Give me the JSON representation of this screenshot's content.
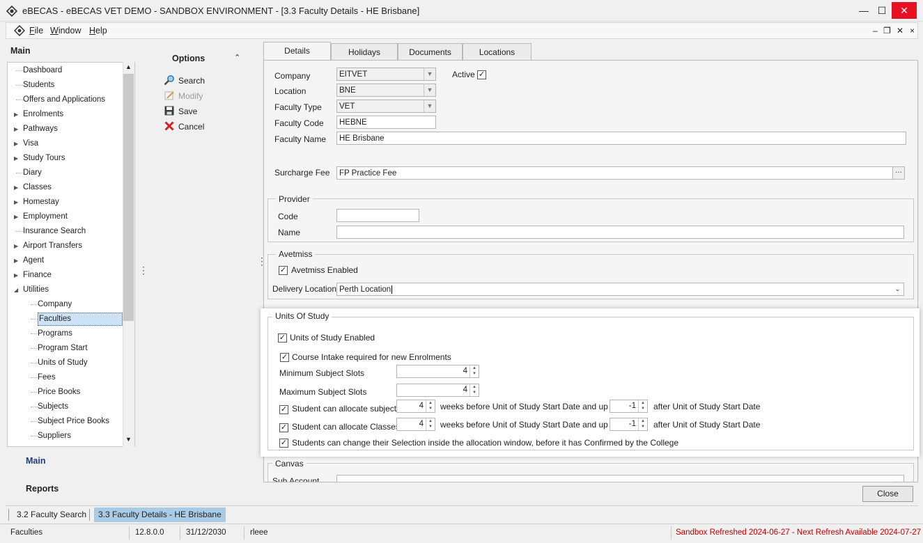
{
  "window": {
    "title": "eBECAS - eBECAS VET DEMO - SANDBOX ENVIRONMENT - [3.3 Faculty Details - HE Brisbane]",
    "minimize_glyph": "—",
    "maximize_glyph": "☐",
    "close_glyph": "✕"
  },
  "menu": {
    "items": [
      "File",
      "Window",
      "Help"
    ],
    "mdi_controls": [
      "‒",
      "❐",
      "✕",
      "×"
    ]
  },
  "nav": {
    "title": "Main",
    "tree": [
      {
        "label": "Dashboard",
        "expandable": false,
        "child": false
      },
      {
        "label": "Students",
        "expandable": false,
        "child": false
      },
      {
        "label": "Offers and Applications",
        "expandable": false,
        "child": false
      },
      {
        "label": "Enrolments",
        "expandable": true,
        "child": false
      },
      {
        "label": "Pathways",
        "expandable": true,
        "child": false
      },
      {
        "label": "Visa",
        "expandable": true,
        "child": false
      },
      {
        "label": "Study Tours",
        "expandable": true,
        "child": false
      },
      {
        "label": "Diary",
        "expandable": false,
        "child": false
      },
      {
        "label": "Classes",
        "expandable": true,
        "child": false
      },
      {
        "label": "Homestay",
        "expandable": true,
        "child": false
      },
      {
        "label": "Employment",
        "expandable": true,
        "child": false
      },
      {
        "label": "Insurance Search",
        "expandable": false,
        "child": false
      },
      {
        "label": "Airport Transfers",
        "expandable": true,
        "child": false
      },
      {
        "label": "Agent",
        "expandable": true,
        "child": false
      },
      {
        "label": "Finance",
        "expandable": true,
        "child": false
      },
      {
        "label": "Utilities",
        "expandable": true,
        "expanded": true,
        "child": false
      },
      {
        "label": "Company",
        "child": true
      },
      {
        "label": "Faculties",
        "child": true,
        "selected": true
      },
      {
        "label": "Programs",
        "child": true
      },
      {
        "label": "Program Start",
        "child": true
      },
      {
        "label": "Units of Study",
        "child": true
      },
      {
        "label": "Fees",
        "child": true
      },
      {
        "label": "Price Books",
        "child": true
      },
      {
        "label": "Subjects",
        "child": true
      },
      {
        "label": "Subject Price Books",
        "child": true
      },
      {
        "label": "Suppliers",
        "child": true
      }
    ],
    "bottom_main": "Main",
    "bottom_reports": "Reports"
  },
  "options": {
    "title": "Options",
    "items": [
      {
        "label": "Search",
        "icon": "search-icon",
        "enabled": true
      },
      {
        "label": "Modify",
        "icon": "modify-icon",
        "enabled": false
      },
      {
        "label": "Save",
        "icon": "save-icon",
        "enabled": true
      },
      {
        "label": "Cancel",
        "icon": "cancel-icon",
        "enabled": true
      }
    ]
  },
  "tabs": [
    "Details",
    "Holidays",
    "Documents",
    "Locations"
  ],
  "details": {
    "company_label": "Company",
    "company_value": "EITVET",
    "active_label": "Active",
    "location_label": "Location",
    "location_value": "BNE",
    "faculty_type_label": "Faculty Type",
    "faculty_type_value": "VET",
    "faculty_code_label": "Faculty Code",
    "faculty_code_value": "HEBNE",
    "faculty_name_label": "Faculty Name",
    "faculty_name_value": "HE Brisbane",
    "surcharge_label": "Surcharge Fee",
    "surcharge_value": "FP Practice Fee",
    "ellipsis": "···"
  },
  "provider": {
    "title": "Provider",
    "code_label": "Code",
    "code_value": "",
    "name_label": "Name",
    "name_value": ""
  },
  "avetmiss": {
    "title": "Avetmiss",
    "enabled_label": "Avetmiss Enabled",
    "delivery_label": "Delivery Location",
    "delivery_value": "Perth Location"
  },
  "units": {
    "title": "Units Of Study",
    "enabled_label": "Units of Study Enabled",
    "intake_label": "Course Intake required for new Enrolments",
    "min_label": "Minimum Subject Slots",
    "min_value": "4",
    "max_label": "Maximum Subject Slots",
    "max_value": "4",
    "subjects_label": "Student can allocate subjects",
    "subjects_weeks": "4",
    "subjects_after": "-1",
    "classes_label": "Student can allocate Classes",
    "classes_weeks": "4",
    "classes_after": "-1",
    "weeks_text": "weeks before Unit of Study Start Date and up to",
    "after_text": "after Unit of Study Start Date",
    "change_label": "Students can change their Selection inside the allocation window, before it has Confirmed by the College"
  },
  "canvas": {
    "title": "Canvas",
    "sub_account_label": "Sub Account"
  },
  "close_label": "Close",
  "window_tabs": [
    "3.2 Faculty Search",
    "3.3 Faculty Details - HE Brisbane"
  ],
  "status": {
    "module": "Faculties",
    "version": "12.8.0.0",
    "date": "31/12/2030",
    "user": "rleee",
    "sandbox": "Sandbox Refreshed 2024-06-27 - Next Refresh Available 2024-07-27"
  },
  "colors": {
    "selected_tab": "#a9cbe6",
    "sandbox_text": "#c00000",
    "close_button": "#e81123"
  }
}
